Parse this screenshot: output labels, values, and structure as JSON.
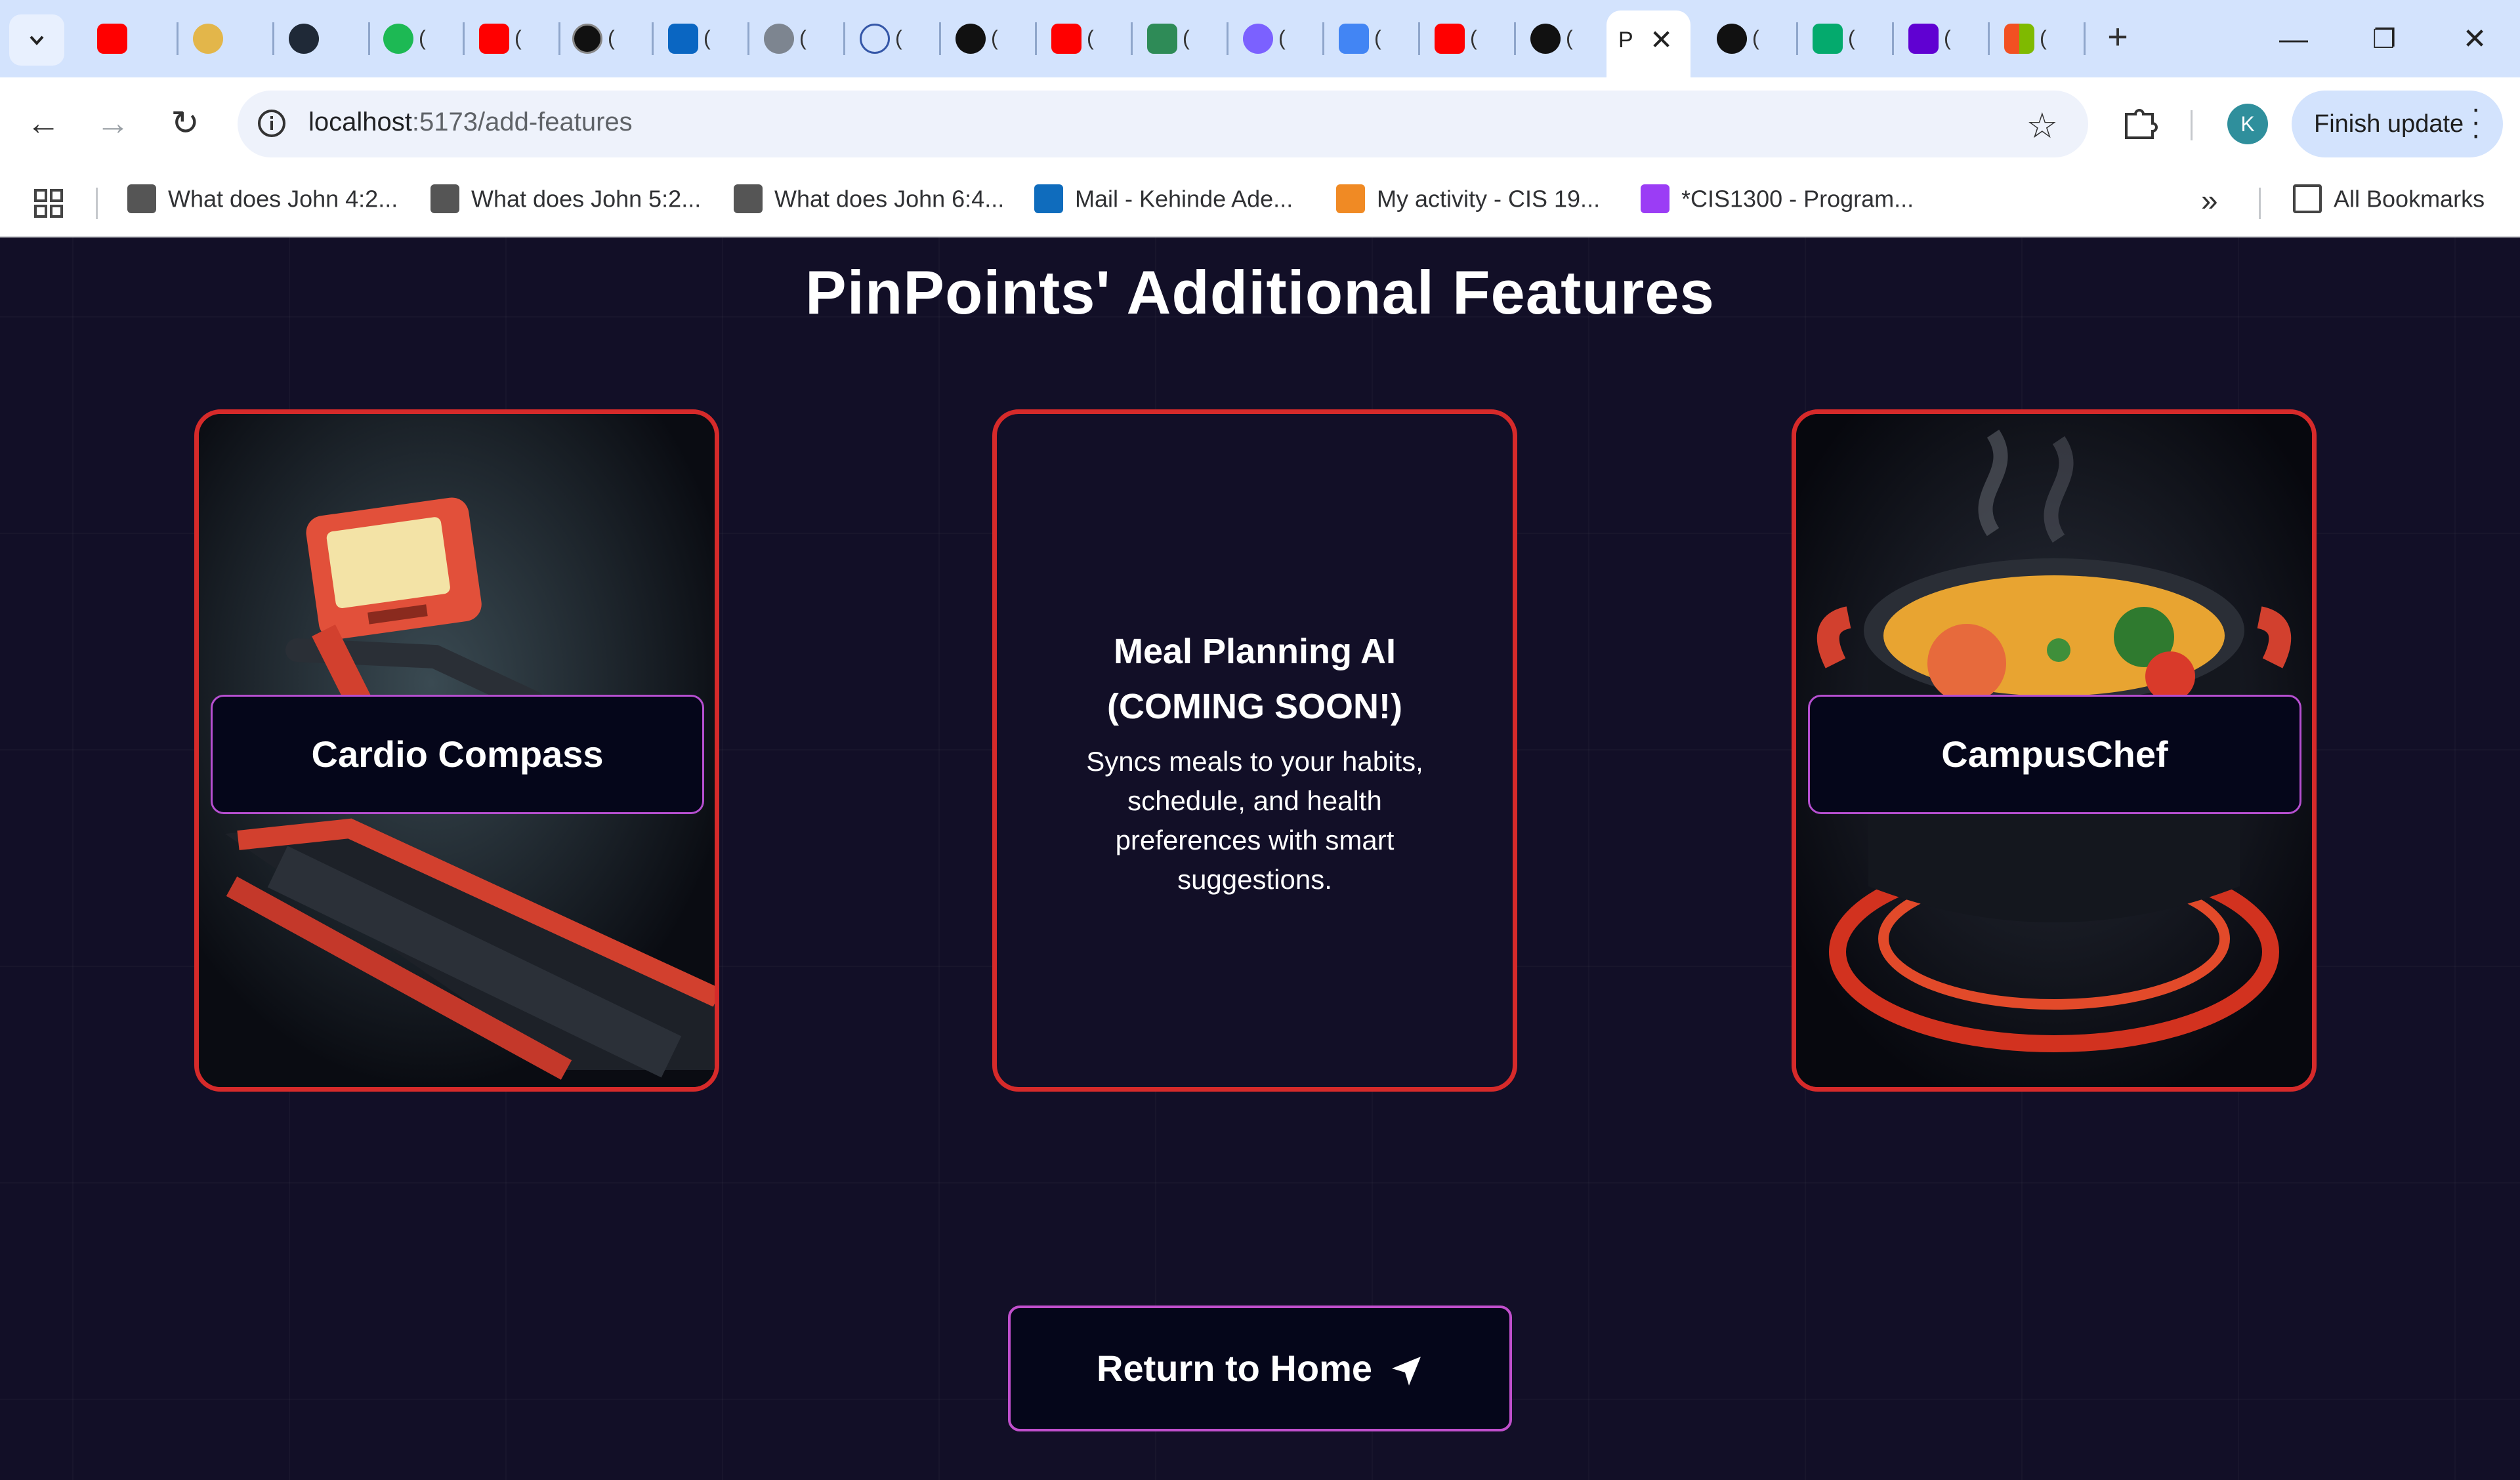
{
  "browser": {
    "tab_titles": [
      "(",
      "(",
      "(",
      "(",
      "(",
      "(",
      "(",
      "(",
      "(",
      "(",
      "(",
      "(",
      "(",
      "(",
      "(",
      "(",
      "(",
      "(",
      "(",
      "(",
      "("
    ],
    "active_tab_title": "P",
    "url_host": "localhost",
    "url_path": ":5173/add-features",
    "profile_initial": "K",
    "finish_update_label": "Finish update",
    "bookmarks": [
      {
        "label": "What does John 4:2...",
        "icon": "bookmark-page-icon"
      },
      {
        "label": "What does John 5:2...",
        "icon": "bookmark-page-icon"
      },
      {
        "label": "What does John 6:4...",
        "icon": "bookmark-page-icon"
      },
      {
        "label": "Mail - Kehinde Ade...",
        "icon": "outlook-icon"
      },
      {
        "label": "My activity - CIS 19...",
        "icon": "zybooks-icon"
      },
      {
        "label": "*CIS1300 - Program...",
        "icon": "tophat-icon"
      }
    ],
    "all_bookmarks_label": "All Bookmarks",
    "colors": {
      "tab_strip": "#d3e3fd",
      "youtube": "#ff0000",
      "avatar": "#2f8f9c"
    }
  },
  "page": {
    "title": "PinPoints' Additional Features",
    "cards": [
      {
        "label": "Cardio Compass",
        "image": "treadmill-illustration"
      },
      {
        "title_line1": "Meal Planning AI",
        "title_line2": "(COMING SOON!)",
        "description": "Syncs meals to your habits, schedule, and health preferences with smart suggestions."
      },
      {
        "label": "CampusChef",
        "image": "cooking-pot-illustration"
      }
    ],
    "return_button_label": "Return to Home",
    "colors": {
      "background": "#120f27",
      "card_border": "#d62a2a",
      "button_border": "#c04fcc"
    }
  }
}
